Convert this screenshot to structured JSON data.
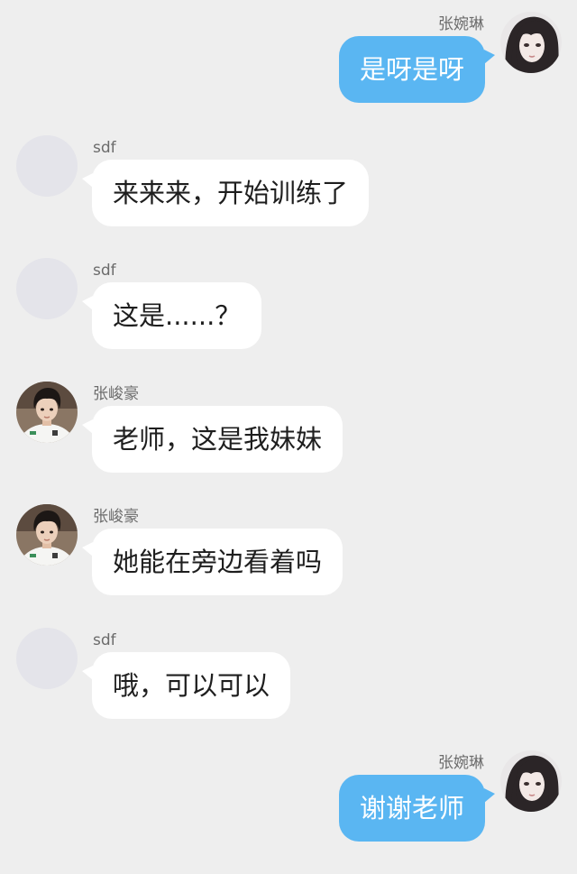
{
  "chat": {
    "colors": {
      "background": "#eeeeee",
      "self_bubble": "#5ab6f2",
      "other_bubble": "#ffffff",
      "blank_avatar": "#e4e4ea"
    },
    "messages": [
      {
        "side": "right",
        "sender": "张婉琳",
        "avatar": "girl-photo",
        "text": "是呀是呀"
      },
      {
        "side": "left",
        "sender": "sdf",
        "avatar": "blank",
        "text": "来来来，开始训练了"
      },
      {
        "side": "left",
        "sender": "sdf",
        "avatar": "blank",
        "text": "这是......？"
      },
      {
        "side": "left",
        "sender": "张峻豪",
        "avatar": "boy-photo",
        "text": "老师，这是我妹妹"
      },
      {
        "side": "left",
        "sender": "张峻豪",
        "avatar": "boy-photo",
        "text": "她能在旁边看着吗"
      },
      {
        "side": "left",
        "sender": "sdf",
        "avatar": "blank",
        "text": "哦，可以可以"
      },
      {
        "side": "right",
        "sender": "张婉琳",
        "avatar": "girl-photo",
        "text": "谢谢老师"
      }
    ]
  }
}
